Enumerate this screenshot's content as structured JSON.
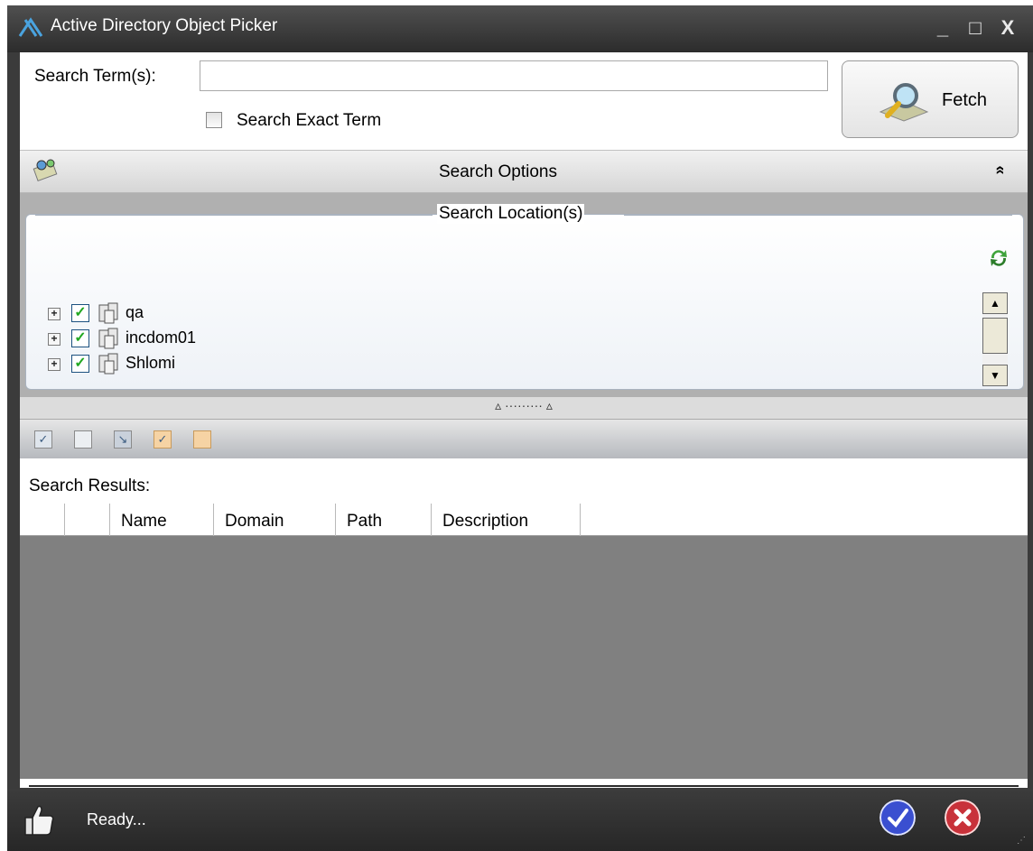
{
  "window": {
    "title": "Active Directory Object Picker",
    "minimize_glyph": "_",
    "maximize_glyph": "□",
    "close_glyph": "X"
  },
  "search": {
    "label": "Search Term(s):",
    "value": "",
    "exact_label": "Search Exact Term",
    "exact_checked": false,
    "fetch_label": "Fetch"
  },
  "options": {
    "title": "Search Options",
    "collapse_glyph": "»"
  },
  "locations": {
    "title": "Search Location(s)",
    "items": [
      {
        "label": "qa",
        "checked": true
      },
      {
        "label": "incdom01",
        "checked": true
      },
      {
        "label": "Shlomi",
        "checked": true
      }
    ]
  },
  "splitter": {
    "glyph": "▵ ········· ▵"
  },
  "results": {
    "label": "Search Results:",
    "columns": [
      "Name",
      "Domain",
      "Path",
      "Description"
    ]
  },
  "status": {
    "text": "Ready..."
  },
  "colors": {
    "title_bg": "#3c3c3c",
    "grid_bg": "#808080",
    "ok_blue": "#3a4fd0",
    "cancel_red": "#c8323a"
  },
  "icons": [
    "app-logo-icon",
    "fetch-magnifier-icon",
    "search-options-icon",
    "refresh-icon",
    "domain-icon",
    "thumbs-up-icon",
    "ok-icon",
    "cancel-icon"
  ]
}
